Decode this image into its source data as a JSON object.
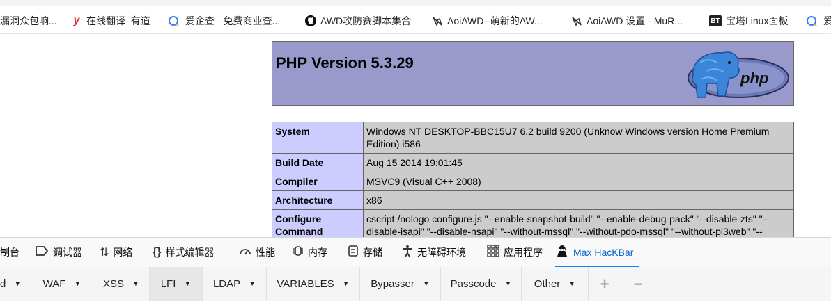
{
  "bookmarks": [
    {
      "label": "漏洞众包响...",
      "icon": "none"
    },
    {
      "label": "在线翻译_有道",
      "icon": "youdao-icon"
    },
    {
      "label": "爱企查 - 免费商业查...",
      "icon": "aiqicha-icon"
    },
    {
      "label": "AWD攻防赛脚本集合",
      "icon": "github-icon"
    },
    {
      "label": "AoiAWD--萌新的AW...",
      "icon": "aoi-icon"
    },
    {
      "label": "AoiAWD 设置 - MuR...",
      "icon": "aoi-icon"
    },
    {
      "label": "宝塔Linux面板",
      "icon": "bt-icon"
    },
    {
      "label": "爱",
      "icon": "aiqicha-icon"
    }
  ],
  "bt_icon_text": "BT",
  "phpinfo": {
    "title": "PHP Version 5.3.29",
    "logo_text": "php",
    "rows": [
      {
        "key": "System",
        "value": "Windows NT DESKTOP-BBC15U7 6.2 build 9200 (Unknow Windows version Home Premium Edition) i586"
      },
      {
        "key": "Build Date",
        "value": "Aug 15 2014 19:01:45"
      },
      {
        "key": "Compiler",
        "value": "MSVC9 (Visual C++ 2008)"
      },
      {
        "key": "Architecture",
        "value": "x86"
      },
      {
        "key": "Configure Command",
        "value": "cscript /nologo configure.js \"--enable-snapshot-build\" \"--enable-debug-pack\" \"--disable-zts\" \"--disable-isapi\" \"--disable-nsapi\" \"--without-mssql\" \"--without-pdo-mssql\" \"--without-pi3web\" \"--"
      }
    ]
  },
  "devtools": {
    "tabs": [
      {
        "label": "制台",
        "icon": "console-icon"
      },
      {
        "label": "调试器",
        "icon": "debugger-icon"
      },
      {
        "label": "网络",
        "icon": "network-icon"
      },
      {
        "label": "样式编辑器",
        "icon": "style-editor-icon"
      },
      {
        "label": "性能",
        "icon": "performance-icon"
      },
      {
        "label": "内存",
        "icon": "memory-icon"
      },
      {
        "label": "存储",
        "icon": "storage-icon"
      },
      {
        "label": "无障碍环境",
        "icon": "accessibility-icon"
      },
      {
        "label": "应用程序",
        "icon": "application-icon"
      },
      {
        "label": "Max HacKBar",
        "icon": "hackbar-icon"
      }
    ],
    "active": "Max HacKBar"
  },
  "hackbar": {
    "menus": [
      "d",
      "WAF",
      "XSS",
      "LFI",
      "LDAP",
      "VARIABLES",
      "Bypasser",
      "Passcode",
      "Other"
    ],
    "selected": "LFI",
    "add_symbol": "+",
    "remove_symbol": "−"
  },
  "colors": {
    "php_header": "#9999cc",
    "key_cell": "#ccccff",
    "value_cell": "#cccccc",
    "active_tab": "#0a84ff"
  }
}
